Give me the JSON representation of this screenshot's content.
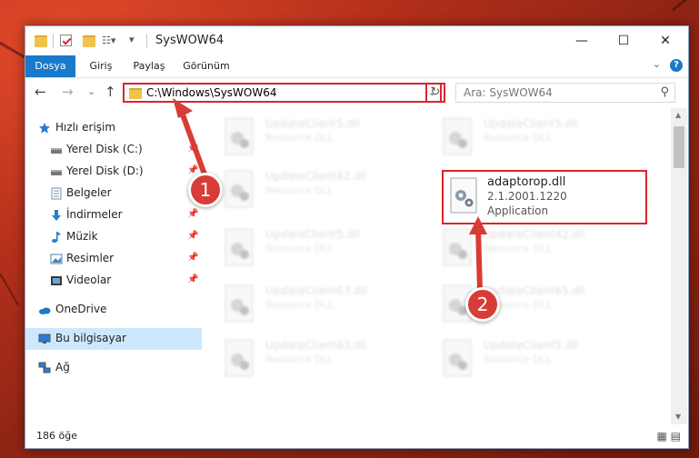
{
  "window": {
    "title": "SysWOW64",
    "quick_access": [
      "new-folder-icon",
      "properties-icon",
      "folder-icon",
      "customize-icon"
    ],
    "controls": {
      "minimize": "—",
      "maximize": "☐",
      "close": "✕"
    }
  },
  "ribbon": {
    "tabs": [
      {
        "label": "Dosya",
        "active": true
      },
      {
        "label": "Giriş",
        "active": false
      },
      {
        "label": "Paylaş",
        "active": false
      },
      {
        "label": "Görünüm",
        "active": false
      }
    ],
    "help": "?",
    "expand": "⌄"
  },
  "navigation": {
    "back": "←",
    "forward": "→",
    "recent": "⌄",
    "up": "↑",
    "address": "C:\\Windows\\SysWOW64",
    "address_dropdown": "⌄",
    "refresh": "↻",
    "search_placeholder": "Ara: SysWOW64",
    "search_glyph": "⚲"
  },
  "sidebar": {
    "items": [
      {
        "label": "Hızlı erişim",
        "icon": "star-icon",
        "pinned": false,
        "selected": false
      },
      {
        "label": "Yerel Disk (C:)",
        "icon": "drive-icon",
        "pinned": true,
        "selected": false
      },
      {
        "label": "Yerel Disk (D:)",
        "icon": "drive-icon",
        "pinned": true,
        "selected": false
      },
      {
        "label": "Belgeler",
        "icon": "documents-icon",
        "pinned": true,
        "selected": false
      },
      {
        "label": "İndirmeler",
        "icon": "download-icon",
        "pinned": true,
        "selected": false
      },
      {
        "label": "Müzik",
        "icon": "music-icon",
        "pinned": true,
        "selected": false
      },
      {
        "label": "Resimler",
        "icon": "pictures-icon",
        "pinned": true,
        "selected": false
      },
      {
        "label": "Videolar",
        "icon": "videos-icon",
        "pinned": true,
        "selected": false
      },
      {
        "label": "OneDrive",
        "icon": "cloud-icon",
        "pinned": false,
        "selected": false
      },
      {
        "label": "Bu bilgisayar",
        "icon": "computer-icon",
        "pinned": false,
        "selected": true
      },
      {
        "label": "Ağ",
        "icon": "network-icon",
        "pinned": false,
        "selected": false
      }
    ]
  },
  "files": {
    "left": [
      {
        "name": "UpdateClient5.dll",
        "type": "Resource DLL"
      },
      {
        "name": "UpdateClient42.dll",
        "type": "Resource DLL"
      },
      {
        "name": "UpdateClient5.dll",
        "type": "Resource DLL"
      },
      {
        "name": "UpdateClient63.dll",
        "type": "Resource DLL"
      },
      {
        "name": "UpdateClient63.dll",
        "type": "Resource DLL"
      }
    ],
    "right": [
      {
        "name": "UpdateClient5.dll",
        "type": "Resource DLL"
      },
      {
        "name": "UpdateClient42.dll",
        "type": "Resource DLL"
      },
      {
        "name": "UpdateClient65.dll",
        "type": "Resource DLL"
      },
      {
        "name": "UpdateClient5.dll",
        "type": "Resource DLL"
      }
    ],
    "highlight": {
      "name": "adaptorop.dll",
      "version": "2.1.2001.1220",
      "type": "Application"
    }
  },
  "annotations": {
    "badge1": "1",
    "badge2": "2"
  },
  "status": {
    "count": "186 öğe",
    "view_icons": "▦ ▤"
  },
  "colors": {
    "accent": "#1979ca",
    "highlight": "#d8262b",
    "selection": "#cce8ff"
  }
}
